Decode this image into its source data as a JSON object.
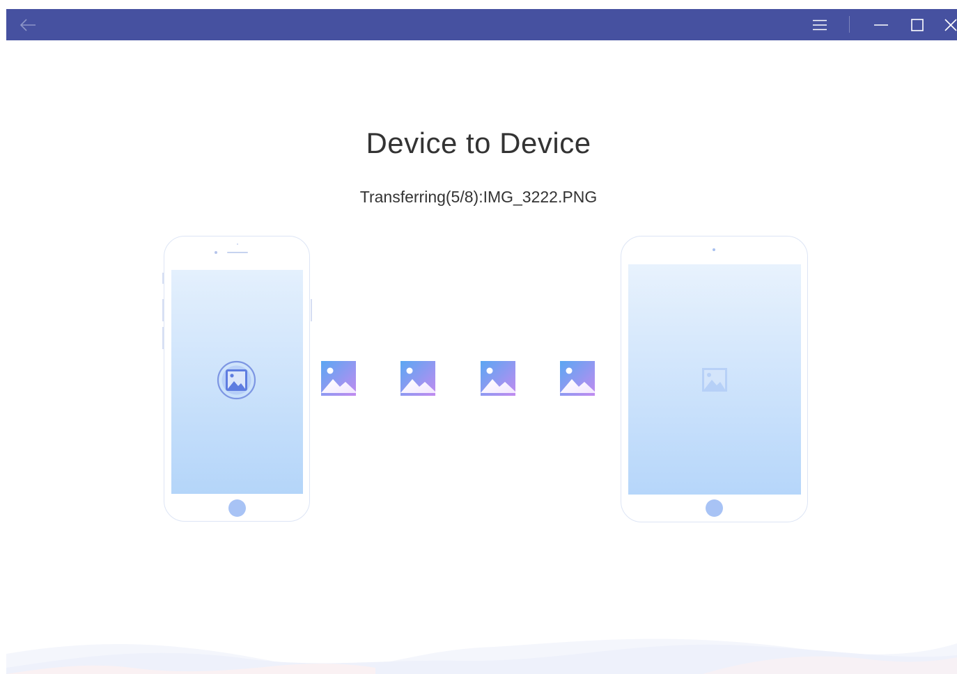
{
  "window": {
    "title": "Device to Device",
    "status": "Transferring(5/8):IMG_3222.PNG"
  },
  "colors": {
    "titlebar": "#4651a0",
    "accent": "#6a8fe8",
    "text": "#333333"
  },
  "icons": {
    "back": "arrow-left-icon",
    "menu": "hamburger-menu-icon",
    "minimize": "minimize-icon",
    "maximize": "maximize-icon",
    "close": "close-icon",
    "photo": "image-icon"
  },
  "transfer": {
    "current": 5,
    "total": 8,
    "filename": "IMG_3222.PNG",
    "source_device": "phone",
    "target_device": "tablet"
  }
}
